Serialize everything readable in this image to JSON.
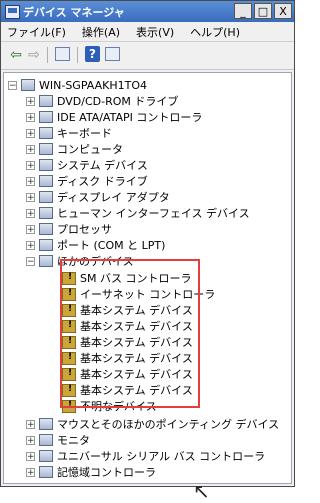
{
  "window": {
    "title": "デバイス マネージャ"
  },
  "caption": {
    "minimize": "_",
    "maximize": "□",
    "close": "X"
  },
  "menu": [
    "ファイル(F)",
    "操作(A)",
    "表示(V)",
    "ヘルプ(H)"
  ],
  "toolbar": {
    "back_icon": "back-arrow-icon",
    "forward_icon": "forward-arrow-icon",
    "help_label": "?"
  },
  "tree": {
    "root": "WIN-SGPAAKH1TO4",
    "categories_top": [
      "DVD/CD-ROM ドライブ",
      "IDE ATA/ATAPI コントローラ",
      "キーボード",
      "コンピュータ",
      "システム デバイス",
      "ディスク ドライブ",
      "ディスプレイ アダプタ",
      "ヒューマン インターフェイス デバイス",
      "プロセッサ",
      "ポート (COM と LPT)"
    ],
    "other_devices": "ほかのデバイス",
    "other_children": [
      "SM バス コントローラ",
      "イーサネット コントローラ",
      "基本システム デバイス",
      "基本システム デバイス",
      "基本システム デバイス",
      "基本システム デバイス",
      "基本システム デバイス",
      "基本システム デバイス",
      "不明なデバイス"
    ],
    "categories_bottom": [
      "マウスとそのほかのポインティング デバイス",
      "モニタ",
      "ユニバーサル シリアル バス コントローラ",
      "記憶域コントローラ"
    ]
  }
}
